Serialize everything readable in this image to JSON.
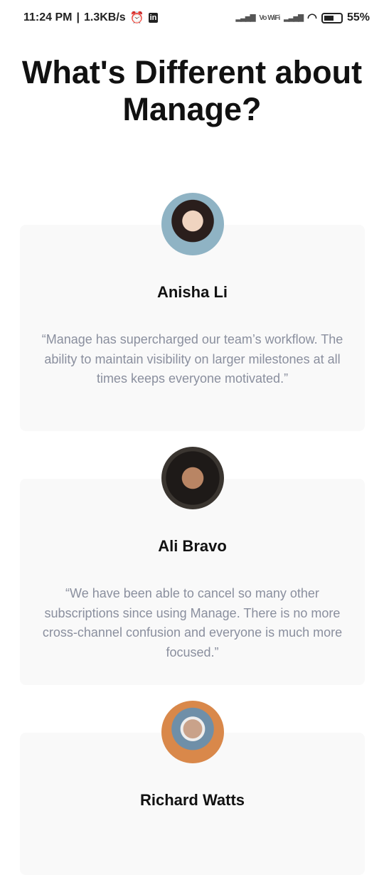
{
  "status_bar": {
    "time": "11:24 PM",
    "speed": "1.3KB/s",
    "alarm_icon": "alarm-icon",
    "app_icon": "in",
    "network": "Vo WiFi",
    "battery": "55%"
  },
  "title": "What's Different about Manage?",
  "testimonials": [
    {
      "name": "Anisha Li",
      "quote": "“Manage has supercharged our team’s workflow. The ability to maintain visibility on larger milestones at all times keeps everyone motivated.”",
      "avatar_color": "#8fb3c4"
    },
    {
      "name": "Ali Bravo",
      "quote": "“We have been able to cancel so many other subscriptions since using Manage. There is no more cross-channel confusion and everyone is much more focused.”",
      "avatar_color": "#3a3530"
    },
    {
      "name": "Richard Watts",
      "quote": "",
      "avatar_color": "#d9884a"
    }
  ]
}
